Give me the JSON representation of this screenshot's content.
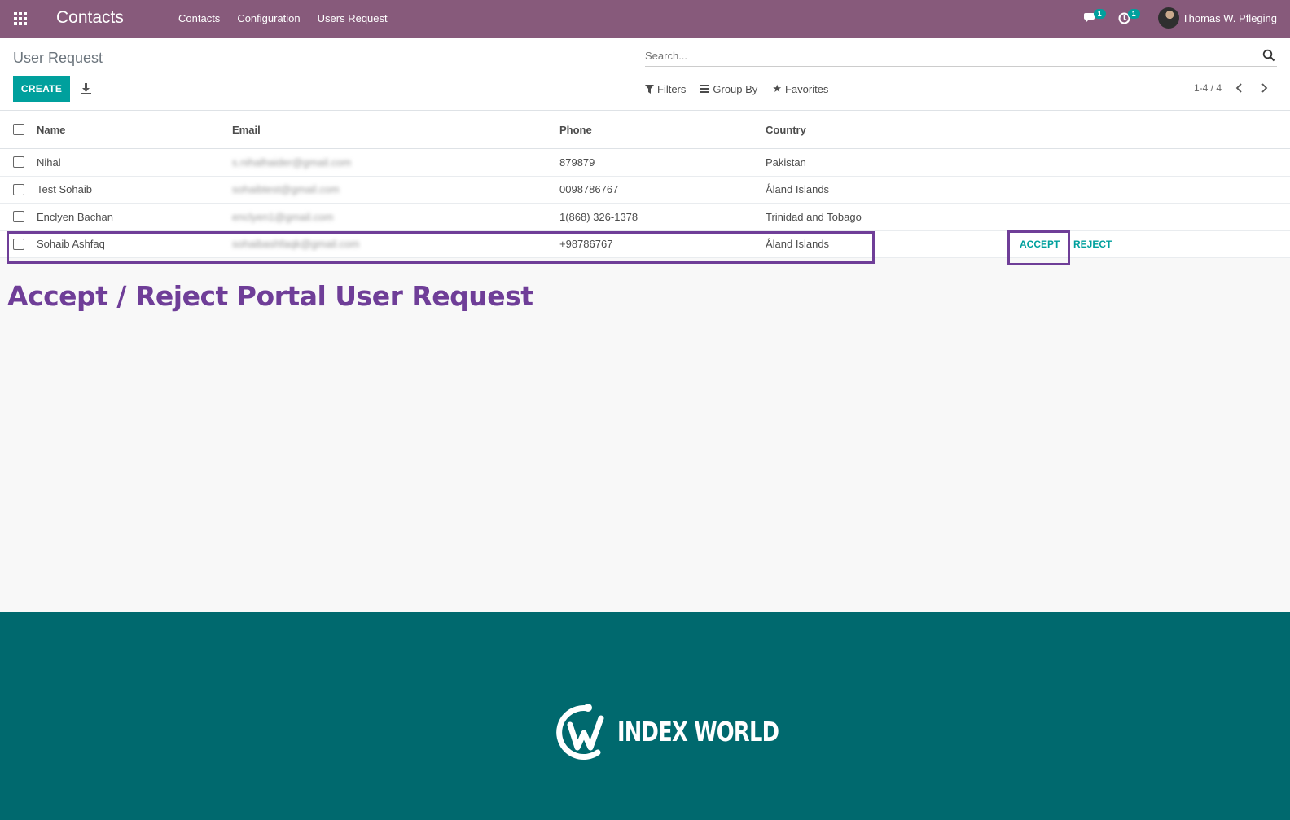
{
  "navbar": {
    "app_title": "Contacts",
    "menu": [
      "Contacts",
      "Configuration",
      "Users Request"
    ],
    "messages_count": "1",
    "activities_count": "1",
    "user_name": "Thomas W. Pfleging"
  },
  "control": {
    "breadcrumb": "User Request",
    "create_label": "CREATE",
    "search_placeholder": "Search...",
    "filters_label": "Filters",
    "groupby_label": "Group By",
    "favorites_label": "Favorites",
    "pager": "1-4 / 4"
  },
  "table": {
    "headers": {
      "name": "Name",
      "email": "Email",
      "phone": "Phone",
      "country": "Country"
    },
    "rows": [
      {
        "name": "Nihal",
        "email": "s.nihalhaider@gmail.com",
        "phone": "879879",
        "country": "Pakistan"
      },
      {
        "name": "Test Sohaib",
        "email": "sohaibtest@gmail.com",
        "phone": "0098786767",
        "country": "Åland Islands"
      },
      {
        "name": "Enclyen Bachan",
        "email": "enclyen1@gmail.com",
        "phone": "1(868) 326-1378",
        "country": "Trinidad and Tobago"
      },
      {
        "name": "Sohaib Ashfaq",
        "email": "sohaibashfaqk@gmail.com",
        "phone": "+98786767",
        "country": "Åland Islands",
        "accept_label": "ACCEPT",
        "reject_label": "REJECT"
      }
    ]
  },
  "caption": "Accept / Reject Portal User Request",
  "footer": {
    "logo_text": "INDEX WORLD"
  },
  "colors": {
    "navbar": "#875a7b",
    "accent": "#00a09d",
    "highlight": "#6f3e98",
    "footer": "#00696e"
  }
}
